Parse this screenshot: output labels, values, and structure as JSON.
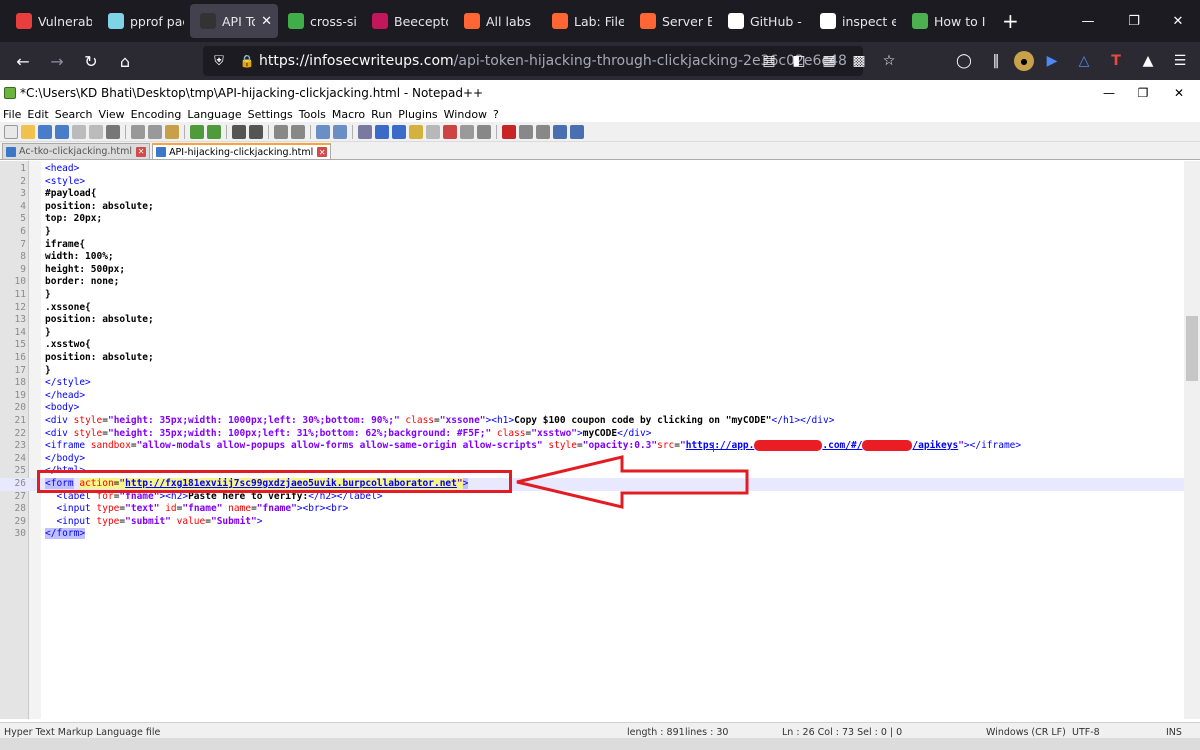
{
  "browser": {
    "tabs": [
      {
        "title": "Vulnerabi",
        "icon": "bug-icon",
        "color": "#e83e3e"
      },
      {
        "title": "pprof pac",
        "icon": "gopher-icon",
        "color": "#7fd3e6"
      },
      {
        "title": "API Tok",
        "icon": "iw-icon",
        "color": "#333333",
        "active": true
      },
      {
        "title": "cross-site",
        "icon": "leaf-icon",
        "color": "#3fae49"
      },
      {
        "title": "Beecepto",
        "icon": "bee-icon",
        "color": "#c2185b"
      },
      {
        "title": "All labs | W",
        "icon": "portswigger-icon",
        "color": "#ff6633"
      },
      {
        "title": "Lab: File p",
        "icon": "portswigger-icon",
        "color": "#ff6633"
      },
      {
        "title": "Server Err",
        "icon": "portswigger-icon",
        "color": "#ff6633"
      },
      {
        "title": "GitHub - p",
        "icon": "github-icon",
        "color": "#ffffff"
      },
      {
        "title": "inspect ele",
        "icon": "google-icon",
        "color": "#ffffff"
      },
      {
        "title": "How to In",
        "icon": "chrome-icon",
        "color": "#4caf50"
      }
    ],
    "url_host": "https://infosecwriteups.com",
    "url_path": "/api-token-hijacking-through-clickjacking-2e36c02e6c48"
  },
  "notepad": {
    "title": "*C:\\Users\\KD Bhati\\Desktop\\tmp\\API-hijacking-clickjacking.html - Notepad++",
    "menu": [
      "File",
      "Edit",
      "Search",
      "View",
      "Encoding",
      "Language",
      "Settings",
      "Tools",
      "Macro",
      "Run",
      "Plugins",
      "Window",
      "?"
    ],
    "file_tabs": [
      {
        "label": "Ac-tko-clickjacking.html",
        "active": false
      },
      {
        "label": "API-hijacking-clickjacking.html",
        "active": true
      }
    ],
    "status": {
      "file_type": "Hyper Text Markup Language file",
      "length": "length : 891",
      "lines": "lines : 30",
      "position": "Ln : 26    Col : 73    Sel : 0 | 0",
      "eol": "Windows (CR LF)",
      "encoding": "UTF-8",
      "mode": "INS"
    }
  }
}
